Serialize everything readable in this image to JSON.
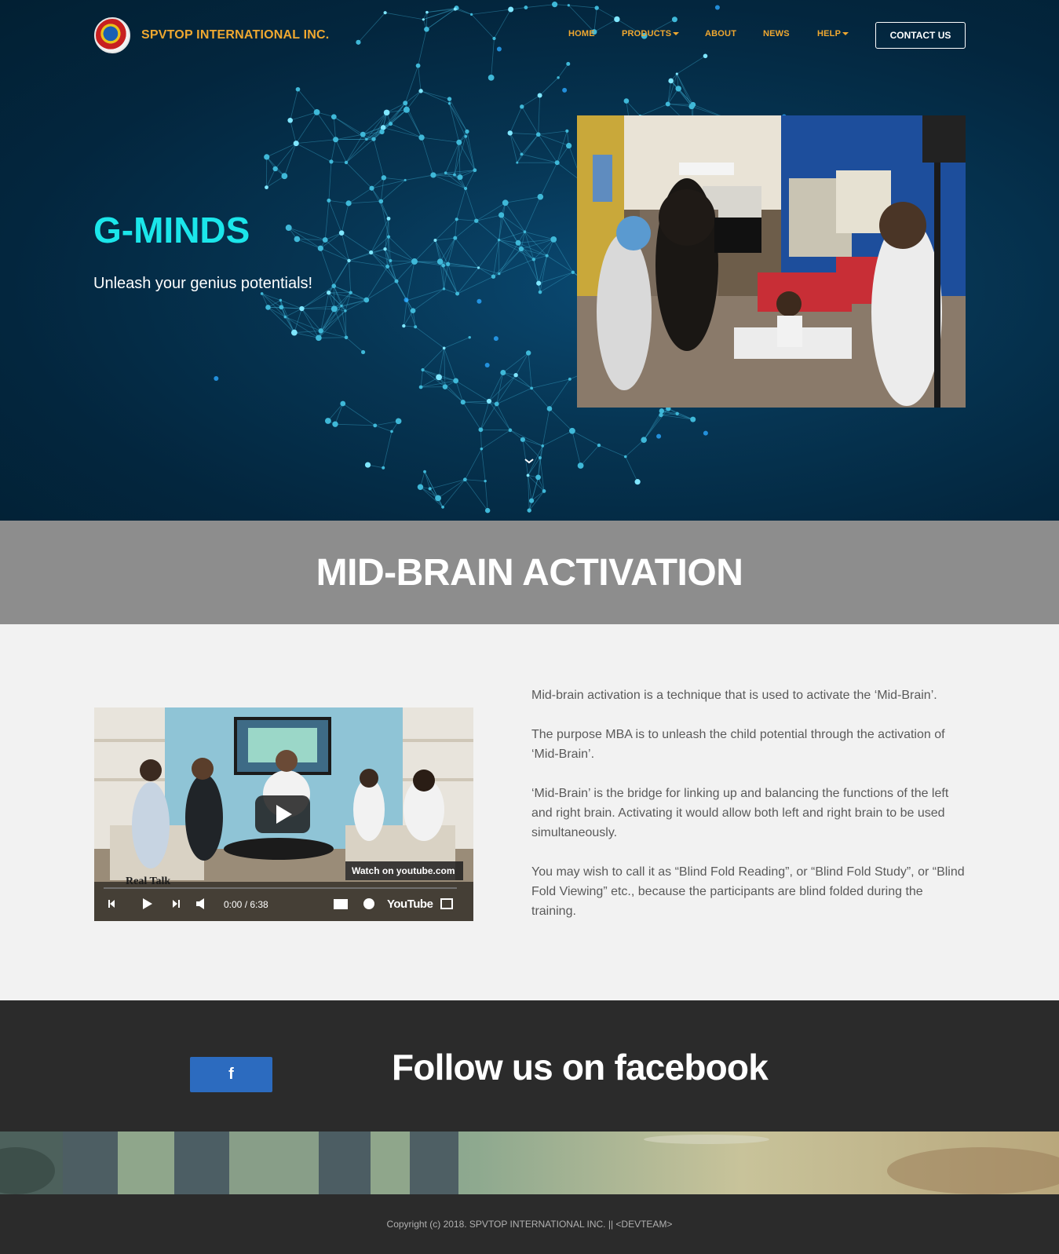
{
  "brand": {
    "name": "SPVTOP INTERNATIONAL INC."
  },
  "nav": {
    "items": [
      {
        "label": "HOME"
      },
      {
        "label": "PRODUCTS"
      },
      {
        "label": "ABOUT"
      },
      {
        "label": "NEWS"
      },
      {
        "label": "HELP"
      }
    ],
    "contact_label": "CONTACT US"
  },
  "hero": {
    "title": "G-MINDS",
    "subtitle": "Unleash your genius potentials!"
  },
  "section": {
    "title": "MID-BRAIN ACTIVATION"
  },
  "video": {
    "overlay_sign": "Real Talk",
    "watch_label": "Watch on youtube.com",
    "time": "0:00 / 6:38",
    "brand": "YouTube"
  },
  "paragraphs": [
    "Mid-brain activation is a technique that is used to activate the ‘Mid-Brain’.",
    "The purpose MBA is to unleash the child potential through the activation of ‘Mid-Brain’.",
    "‘Mid-Brain’ is the bridge for linking up and balancing the functions of the left and right brain. Activating it would allow both left and right brain to be used simultaneously.",
    "You may wish to call it as “Blind Fold Reading”, or “Blind Fold Study”, or “Blind Fold Viewing” etc., because the participants are blind folded during the training."
  ],
  "facebook": {
    "heading": "Follow us on facebook",
    "icon_label": "f"
  },
  "footer": {
    "copyright": "Copyright (c) 2018. SPVTOP INTERNATIONAL INC. || <DEVTEAM>"
  },
  "colors": {
    "hero_bg": "#03263e",
    "accent_orange": "#f0a830",
    "title_cyan": "#1be6ea",
    "section_bar": "#8d8d8d",
    "dark_strip": "#2b2b2b",
    "facebook_blue": "#2c6bbf"
  }
}
